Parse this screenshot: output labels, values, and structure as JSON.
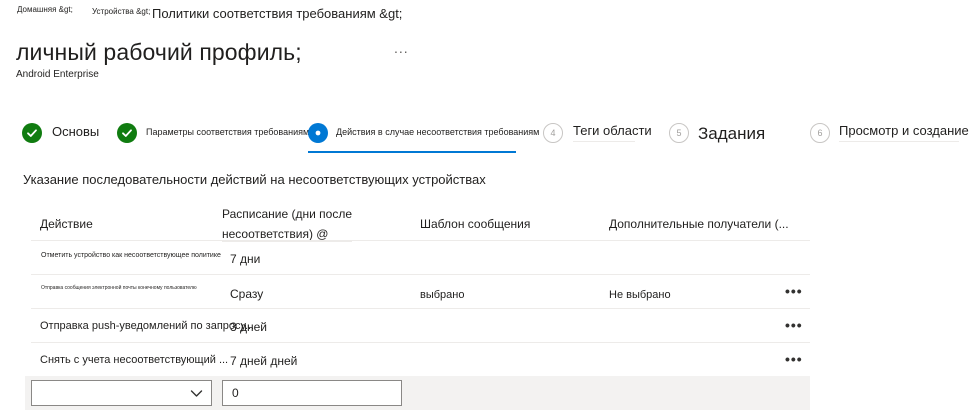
{
  "breadcrumb": {
    "home": "Домашняя &gt;",
    "devices": "Устройства &gt;",
    "policies": "Политики соответствия требованиям &gt;"
  },
  "page": {
    "title": "личный рабочий профиль;",
    "more": "...",
    "subtitle": "Android Enterprise"
  },
  "wizard": {
    "steps": [
      {
        "label": "Основы",
        "state": "done"
      },
      {
        "label": "Параметры соответствия требованиям",
        "state": "done"
      },
      {
        "label": "Действия в случае несоответствия требованиям",
        "state": "current"
      },
      {
        "number": "4",
        "label": "Теги области",
        "state": "pending"
      },
      {
        "number": "5",
        "label": "Задания",
        "state": "pending"
      },
      {
        "number": "6",
        "label": "Просмотр и создание",
        "state": "pending"
      }
    ]
  },
  "section": {
    "description": "Указание последовательности действий на несоответствующих устройствах"
  },
  "table": {
    "columns": {
      "action": "Действие",
      "schedule_line1": "Расписание (дни после",
      "schedule_line2": "несоответствия) @",
      "template": "Шаблон сообщения",
      "recipients": "Дополнительные получатели (..."
    },
    "rows": [
      {
        "action": "Отметить устройство как несоответствующее политике",
        "schedule": "7 дни",
        "template": "",
        "recipients": "",
        "more": ""
      },
      {
        "action": "Отправка сообщения электронной почты конечному пользователю",
        "schedule": "Сразу",
        "template": "выбрано",
        "recipients": "Не выбрано",
        "more": "•••"
      },
      {
        "action": "Отправка push-уведомлений по запросу...",
        "schedule": "3 дней",
        "template": "",
        "recipients": "",
        "more": "•••"
      },
      {
        "action": "Снять с учета несоответствующий ...",
        "schedule": "7 дней дней",
        "template": "",
        "recipients": "",
        "more": "•••"
      }
    ]
  },
  "new_action": {
    "select_value": "",
    "days_value": "0"
  },
  "colors": {
    "accent": "#0078d4",
    "success": "#107c10",
    "footer_bg": "#f3f2f1"
  }
}
